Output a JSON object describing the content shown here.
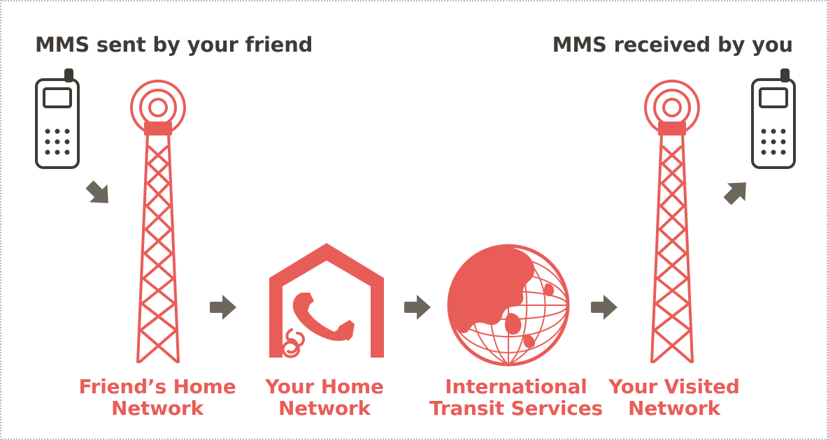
{
  "headings": {
    "sent": "MMS sent by your friend",
    "received": "MMS received by you"
  },
  "nodes": [
    {
      "line1": "Friend’s Home",
      "line2": "Network"
    },
    {
      "line1": "Your Home",
      "line2": "Network"
    },
    {
      "line1": "International",
      "line2": "Transit Services"
    },
    {
      "line1": "Your Visited",
      "line2": "Network"
    }
  ],
  "colors": {
    "primary": "#e95d58",
    "text_dark": "#3f3a35",
    "arrow": "#6d665d"
  },
  "icons": [
    "sender-phone-icon",
    "friend-tower-icon",
    "home-network-icon",
    "globe-icon",
    "visited-tower-icon",
    "receiver-phone-icon"
  ]
}
